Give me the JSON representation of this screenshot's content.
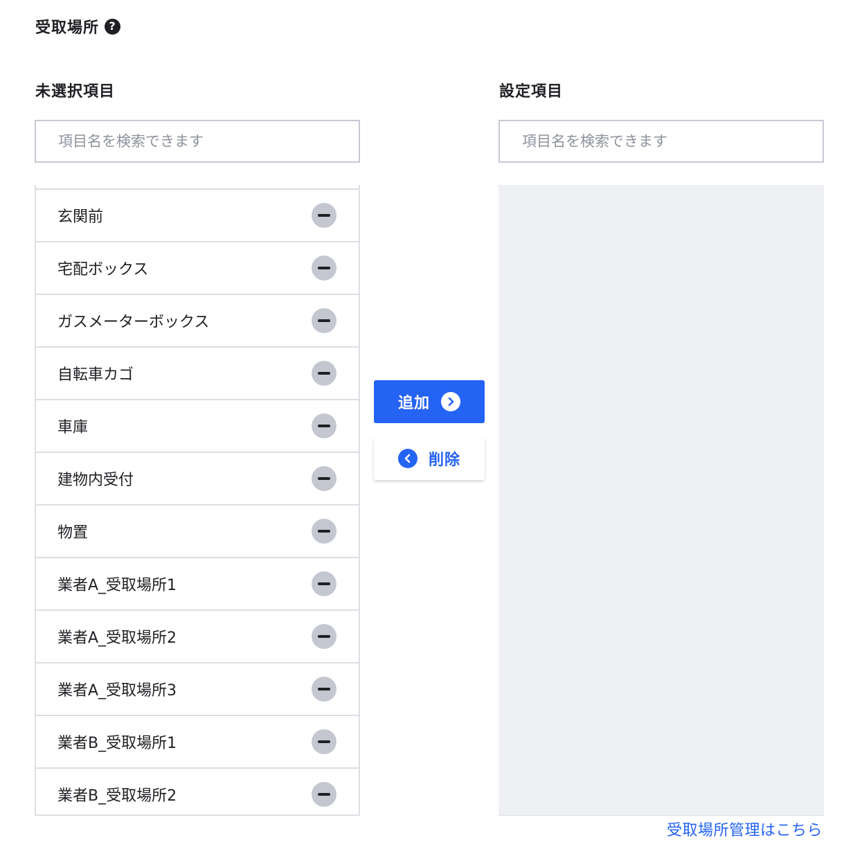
{
  "section": {
    "title": "受取場所",
    "help_icon": "question-circle-icon"
  },
  "unselected": {
    "title": "未選択項目",
    "search_placeholder": "項目名を検索できます",
    "items": [
      {
        "label": "玄関前"
      },
      {
        "label": "宅配ボックス"
      },
      {
        "label": "ガスメーターボックス"
      },
      {
        "label": "自転車カゴ"
      },
      {
        "label": "車庫"
      },
      {
        "label": "建物内受付"
      },
      {
        "label": "物置"
      },
      {
        "label": "業者A_受取場所1"
      },
      {
        "label": "業者A_受取場所2"
      },
      {
        "label": "業者A_受取場所3"
      },
      {
        "label": "業者B_受取場所1"
      },
      {
        "label": "業者B_受取場所2"
      }
    ]
  },
  "selected": {
    "title": "設定項目",
    "search_placeholder": "項目名を検索できます",
    "items": []
  },
  "actions": {
    "add_label": "追加",
    "remove_label": "削除"
  },
  "footer": {
    "manage_link": "受取場所管理はこちら"
  },
  "colors": {
    "accent": "#2563f5",
    "panel_bg": "#eff0f4",
    "border": "#dcdee4",
    "minus_bg": "#c4c6d0"
  }
}
